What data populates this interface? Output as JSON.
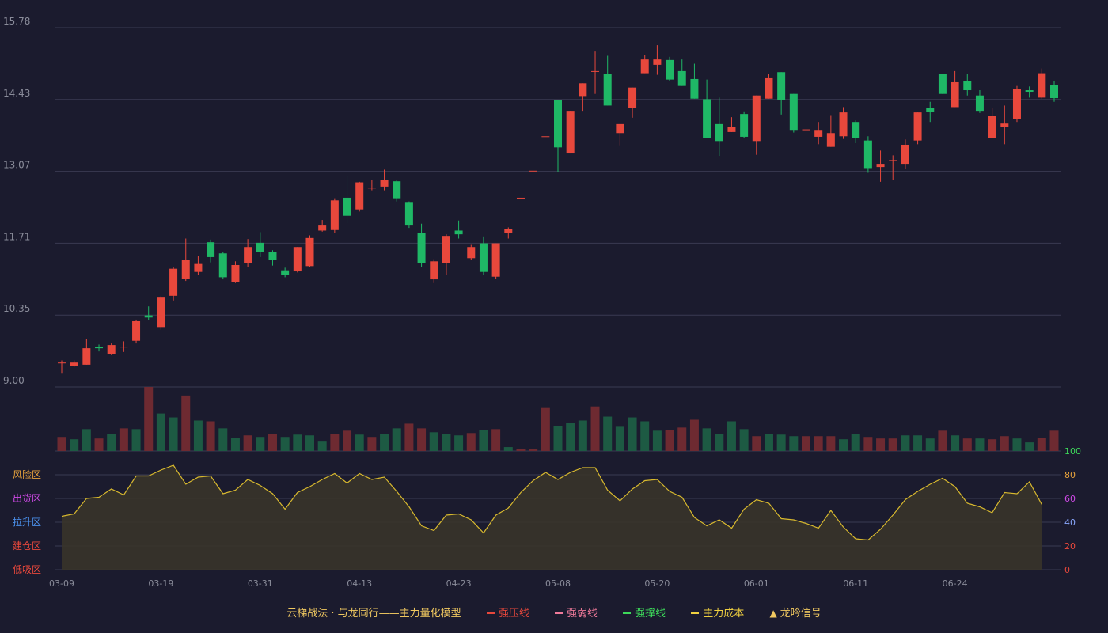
{
  "colors": {
    "background": "#1b1b2e",
    "grid": "#3a3b52",
    "up": "#e8483c",
    "down": "#1fb866",
    "axis_text": "#8a8c9a",
    "kdj_line": "#d8b92e"
  },
  "chart_data": [
    {
      "type": "candlestick",
      "title": "",
      "y_ticks": [
        "15.78",
        "14.43",
        "13.07",
        "11.71",
        "10.35",
        "9.00"
      ],
      "ylim": [
        9.0,
        15.78
      ],
      "grid": true,
      "x_ticks": [
        "03-09",
        "03-19",
        "03-31",
        "04-13",
        "04-23",
        "05-08",
        "05-20",
        "06-01",
        "06-11",
        "06-24"
      ],
      "x_tick_index": [
        0,
        8,
        16,
        24,
        32,
        40,
        48,
        56,
        64,
        72
      ],
      "ohlc": [
        [
          9.46,
          9.46,
          9.25,
          9.5
        ],
        [
          9.4,
          9.46,
          9.38,
          9.5
        ],
        [
          9.42,
          9.73,
          9.42,
          9.9
        ],
        [
          9.76,
          9.73,
          9.67,
          9.8
        ],
        [
          9.62,
          9.79,
          9.6,
          9.82
        ],
        [
          9.76,
          9.76,
          9.66,
          9.86
        ],
        [
          9.87,
          10.24,
          9.82,
          10.27
        ],
        [
          10.35,
          10.31,
          10.26,
          10.52
        ],
        [
          10.13,
          10.7,
          10.08,
          10.72
        ],
        [
          10.72,
          11.23,
          10.63,
          11.27
        ],
        [
          11.04,
          11.39,
          11.0,
          11.8
        ],
        [
          11.17,
          11.32,
          11.12,
          11.47
        ],
        [
          11.73,
          11.45,
          11.35,
          11.78
        ],
        [
          11.52,
          11.07,
          11.03,
          11.54
        ],
        [
          10.98,
          11.3,
          10.96,
          11.37
        ],
        [
          11.33,
          11.64,
          11.26,
          11.79
        ],
        [
          11.72,
          11.55,
          11.45,
          11.92
        ],
        [
          11.55,
          11.4,
          11.29,
          11.58
        ],
        [
          11.2,
          11.12,
          11.07,
          11.25
        ],
        [
          11.18,
          11.64,
          11.16,
          11.64
        ],
        [
          11.28,
          11.81,
          11.26,
          11.86
        ],
        [
          11.95,
          12.06,
          11.93,
          12.15
        ],
        [
          11.96,
          12.52,
          11.91,
          12.56
        ],
        [
          12.57,
          12.23,
          12.09,
          12.97
        ],
        [
          12.35,
          12.86,
          12.31,
          12.87
        ],
        [
          12.76,
          12.76,
          12.71,
          12.91
        ],
        [
          12.78,
          12.9,
          12.71,
          13.1
        ],
        [
          12.88,
          12.56,
          12.5,
          12.9
        ],
        [
          12.49,
          12.06,
          12.0,
          12.5
        ],
        [
          11.91,
          11.33,
          11.26,
          12.08
        ],
        [
          11.03,
          11.37,
          10.96,
          11.41
        ],
        [
          11.33,
          11.85,
          11.11,
          11.88
        ],
        [
          11.95,
          11.88,
          11.8,
          12.14
        ],
        [
          11.43,
          11.64,
          11.4,
          11.68
        ],
        [
          11.71,
          11.17,
          11.12,
          11.84
        ],
        [
          11.08,
          11.71,
          11.04,
          11.71
        ],
        [
          11.9,
          11.98,
          11.8,
          12.01
        ],
        [
          12.57,
          12.57,
          12.57,
          12.57
        ],
        [
          13.08,
          13.08,
          13.08,
          13.08
        ],
        [
          13.73,
          13.73,
          13.73,
          13.73
        ],
        [
          14.42,
          13.52,
          13.06,
          14.42
        ],
        [
          13.42,
          14.21,
          13.42,
          14.21
        ],
        [
          14.49,
          14.73,
          14.21,
          14.73
        ],
        [
          14.96,
          14.96,
          14.53,
          15.33
        ],
        [
          14.91,
          14.31,
          14.31,
          15.25
        ],
        [
          13.79,
          13.96,
          13.56,
          13.96
        ],
        [
          14.27,
          14.65,
          14.08,
          14.65
        ],
        [
          14.92,
          15.18,
          14.92,
          15.26
        ],
        [
          15.08,
          15.18,
          14.89,
          15.45
        ],
        [
          15.17,
          14.8,
          14.77,
          15.23
        ],
        [
          14.96,
          14.68,
          14.68,
          15.18
        ],
        [
          14.81,
          14.44,
          14.44,
          15.1
        ],
        [
          14.43,
          13.7,
          13.72,
          14.8
        ],
        [
          13.96,
          13.64,
          13.36,
          14.46
        ],
        [
          13.81,
          13.91,
          13.81,
          14.09
        ],
        [
          14.15,
          13.72,
          13.7,
          14.2
        ],
        [
          13.64,
          14.5,
          13.38,
          14.5
        ],
        [
          14.44,
          14.84,
          14.44,
          14.9
        ],
        [
          14.94,
          14.41,
          14.14,
          14.94
        ],
        [
          14.53,
          13.85,
          13.8,
          14.53
        ],
        [
          13.86,
          13.86,
          13.86,
          14.27
        ],
        [
          13.72,
          13.85,
          13.58,
          14.0
        ],
        [
          13.53,
          13.79,
          13.53,
          14.13
        ],
        [
          13.73,
          14.18,
          13.68,
          14.28
        ],
        [
          14.0,
          13.7,
          13.6,
          14.03
        ],
        [
          13.65,
          13.13,
          13.04,
          13.73
        ],
        [
          13.15,
          13.21,
          12.87,
          13.46
        ],
        [
          13.28,
          13.28,
          12.91,
          13.37
        ],
        [
          13.21,
          13.57,
          13.12,
          13.67
        ],
        [
          13.65,
          14.18,
          13.58,
          14.18
        ],
        [
          14.27,
          14.19,
          14.0,
          14.38
        ],
        [
          14.91,
          14.53,
          14.53,
          14.91
        ],
        [
          14.28,
          14.75,
          14.28,
          14.96
        ],
        [
          14.77,
          14.6,
          14.5,
          14.9
        ],
        [
          14.5,
          14.21,
          14.17,
          14.6
        ],
        [
          13.7,
          14.11,
          13.7,
          14.27
        ],
        [
          13.9,
          13.97,
          13.58,
          14.31
        ],
        [
          14.05,
          14.63,
          14.0,
          14.68
        ],
        [
          14.6,
          14.57,
          14.46,
          14.67
        ],
        [
          14.46,
          14.92,
          14.44,
          15.01
        ],
        [
          14.69,
          14.45,
          14.38,
          14.78
        ]
      ]
    },
    {
      "type": "bar",
      "title": "",
      "volume": [
        18,
        15,
        28,
        16,
        22,
        29,
        28,
        82,
        48,
        43,
        71,
        39,
        38,
        29,
        17,
        20,
        18,
        22,
        18,
        21,
        20,
        13,
        22,
        26,
        21,
        18,
        22,
        29,
        35,
        29,
        24,
        22,
        20,
        23,
        27,
        28,
        5,
        3,
        2,
        55,
        32,
        36,
        39,
        57,
        44,
        31,
        43,
        38,
        26,
        27,
        30,
        40,
        29,
        22,
        38,
        28,
        19,
        22,
        21,
        19,
        19,
        19,
        19,
        15,
        22,
        18,
        16,
        16,
        20,
        20,
        16,
        26,
        20,
        16,
        16,
        15,
        19,
        16,
        11,
        17,
        26
      ],
      "volume_up": [
        true,
        false,
        false,
        true,
        false,
        true,
        false,
        true,
        false,
        false,
        true,
        false,
        true,
        false,
        false,
        true,
        false,
        true,
        false,
        false,
        false,
        false,
        true,
        true,
        false,
        true,
        false,
        false,
        true,
        true,
        false,
        false,
        false,
        true,
        false,
        true,
        false,
        true,
        true,
        true,
        false,
        false,
        false,
        true,
        false,
        false,
        false,
        false,
        false,
        true,
        true,
        true,
        false,
        false,
        false,
        false,
        true,
        false,
        false,
        false,
        true,
        true,
        true,
        false,
        false,
        true,
        true,
        true,
        false,
        false,
        false,
        true,
        false,
        true,
        false,
        true,
        true,
        false,
        false,
        true,
        true
      ],
      "ylim": [
        0,
        82
      ]
    },
    {
      "type": "area",
      "title": "",
      "zone_labels": [
        "风险区",
        "出货区",
        "拉升区",
        "建仓区",
        "低吸区"
      ],
      "zone_colors": [
        "#e8a33c",
        "#d04ae8",
        "#4a8ee8",
        "#e8483c",
        "#e8483c"
      ],
      "right_ticks": [
        "100",
        "80",
        "60",
        "40",
        "20",
        "0"
      ],
      "right_tick_colors": [
        "#3dd85a",
        "#e8a33c",
        "#d04ae8",
        "#8aa8ff",
        "#e8483c",
        "#e8483c"
      ],
      "ylim": [
        0,
        100
      ],
      "values": [
        45,
        47,
        60,
        61,
        68,
        63,
        79,
        79,
        84,
        88,
        72,
        78,
        79,
        64,
        67,
        76,
        71,
        64,
        51,
        65,
        70,
        76,
        81,
        73,
        81,
        76,
        78,
        66,
        53,
        37,
        33,
        46,
        47,
        42,
        31,
        46,
        52,
        65,
        75,
        82,
        76,
        82,
        86,
        86,
        67,
        58,
        68,
        75,
        76,
        66,
        61,
        44,
        37,
        42,
        35,
        51,
        59,
        56,
        43,
        42,
        39,
        35,
        50,
        36,
        26,
        25,
        34,
        46,
        59,
        66,
        72,
        77,
        70,
        56,
        53,
        48,
        65,
        64,
        74,
        55
      ]
    }
  ],
  "legend": [
    {
      "label": "云梯战法 · 与龙同行——主力量化模型",
      "color": "#f0c860",
      "swatch": "none"
    },
    {
      "label": "强压线",
      "color": "#e8483c",
      "swatch": "line"
    },
    {
      "label": "强弱线",
      "color": "#f07a9a",
      "swatch": "dash"
    },
    {
      "label": "强撑线",
      "color": "#3dd85a",
      "swatch": "line"
    },
    {
      "label": "主力成本",
      "color": "#f0d040",
      "swatch": "dash"
    },
    {
      "label": "龙吟信号",
      "color": "#f0c860",
      "swatch": "triangle",
      "symbol": "▲"
    }
  ]
}
